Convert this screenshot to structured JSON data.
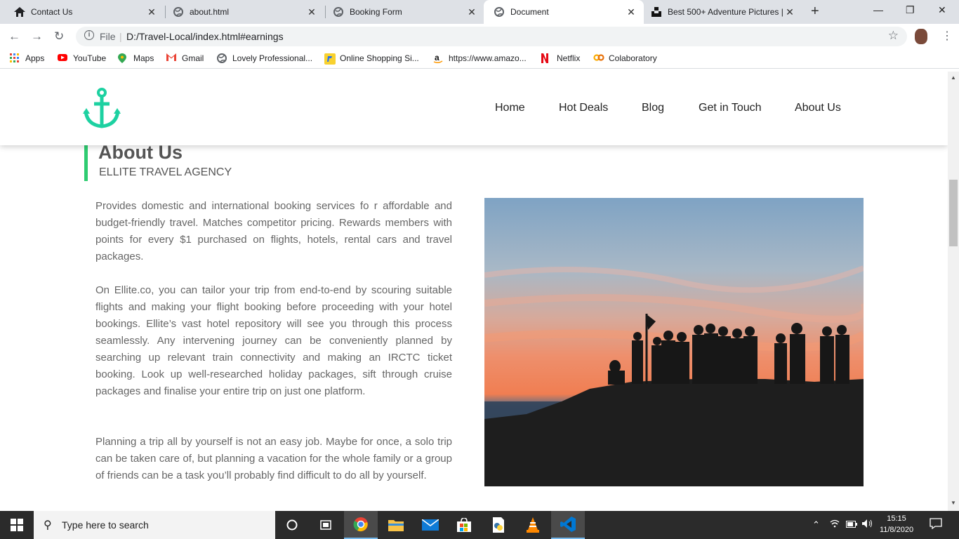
{
  "browser": {
    "tabs": [
      {
        "title": "Contact Us",
        "icon": "home-icon"
      },
      {
        "title": "about.html",
        "icon": "globe-icon"
      },
      {
        "title": "Booking Form",
        "icon": "globe-icon"
      },
      {
        "title": "Document",
        "icon": "globe-icon",
        "active": true
      },
      {
        "title": "Best 500+ Adventure Pictures |",
        "icon": "unsplash-icon"
      }
    ],
    "close_glyph": "✕",
    "new_tab_glyph": "+",
    "window_controls": {
      "minimize": "—",
      "restore": "❐",
      "close": "✕"
    },
    "address": {
      "scheme_label": "File",
      "url": "D:/Travel-Local/index.html#earnings"
    },
    "bookmarks": [
      {
        "label": "Apps",
        "icon": "apps-grid-icon"
      },
      {
        "label": "YouTube",
        "icon": "youtube-icon"
      },
      {
        "label": "Maps",
        "icon": "maps-pin-icon"
      },
      {
        "label": "Gmail",
        "icon": "gmail-icon"
      },
      {
        "label": "Lovely Professional...",
        "icon": "globe-icon"
      },
      {
        "label": "Online Shopping Si...",
        "icon": "flipkart-icon"
      },
      {
        "label": "https://www.amazo...",
        "icon": "amazon-icon"
      },
      {
        "label": "Netflix",
        "icon": "netflix-icon"
      },
      {
        "label": "Colaboratory",
        "icon": "colab-icon"
      }
    ]
  },
  "site": {
    "nav": [
      "Home",
      "Hot Deals",
      "Blog",
      "Get in Touch",
      "About Us"
    ],
    "accent": "#1dd1a1",
    "heading": "About Us",
    "subheading": "ELLITE TRAVEL AGENCY",
    "paragraphs": [
      "Provides domestic and international booking services fo r affordable and budget-friendly travel. Matches competitor pricing. Rewards members with points for every $1 purchased on flights, hotels, rental cars and travel packages.",
      "On Ellite.co, you can tailor your trip from end-to-end by scouring suitable flights and making your flight booking before proceeding with your hotel bookings. Ellite’s vast hotel repository will see you through this process seamlessly. Any intervening journey can be conveniently planned by searching up relevant train connectivity and making an IRCTC ticket booking. Look up well-researched holiday packages, sift through cruise packages and finalise your entire trip on just one platform.",
      "Planning a trip all by yourself is not an easy job. Maybe for once, a solo trip can be taken care of, but planning a vacation for the whole family or a group of friends can be a task you’ll probably find difficult to do all by yourself."
    ]
  },
  "taskbar": {
    "search_placeholder": "Type here to search",
    "time": "15:15",
    "date": "11/8/2020"
  }
}
